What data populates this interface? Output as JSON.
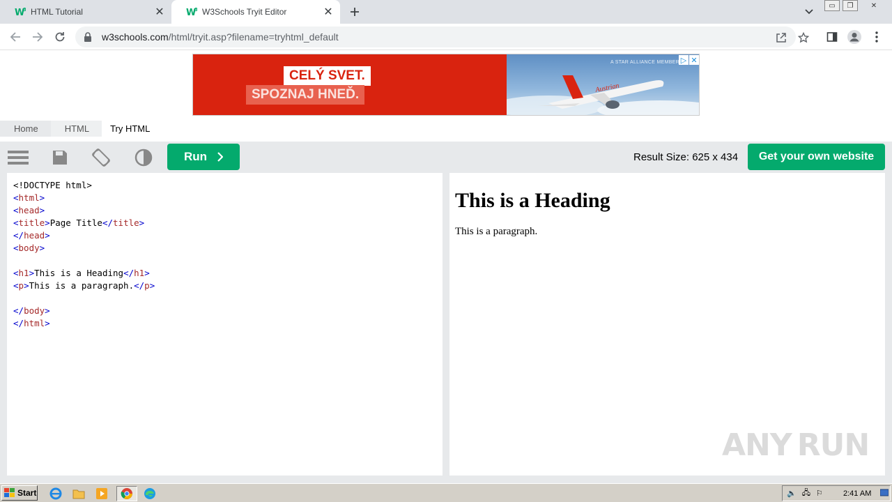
{
  "browser": {
    "tabs": [
      {
        "title": "HTML Tutorial",
        "active": false
      },
      {
        "title": "W3Schools Tryit Editor",
        "active": true
      }
    ],
    "url": {
      "host": "w3schools.com",
      "path": "/html/tryit.asp?filename=tryhtml_default"
    },
    "icons": {
      "back": "arrow-left-icon",
      "forward": "arrow-right-icon",
      "reload": "reload-icon",
      "lock": "lock-icon",
      "share": "share-icon",
      "bookmark": "star-icon",
      "sidepanel": "side-panel-icon",
      "profile": "profile-icon",
      "menu": "kebab-menu-icon"
    }
  },
  "ad": {
    "line1": "CELÝ SVET.",
    "line2": "SPOZNAJ HNEĎ.",
    "alliance": "A STAR ALLIANCE MEMBER",
    "brand": "Austrian",
    "colors": {
      "red": "#d9230f",
      "sky": "#8fb6dc"
    }
  },
  "breadcrumb": [
    "Home",
    "HTML",
    "Try HTML"
  ],
  "editor": {
    "run_label": "Run",
    "result_size": "Result Size: 625 x 434",
    "get_website": "Get your own website",
    "accent": "#04aa6d",
    "code": [
      {
        "parts": [
          {
            "t": "<!DOCTYPE html>",
            "c": "plain"
          }
        ]
      },
      {
        "parts": [
          {
            "t": "<",
            "c": "br"
          },
          {
            "t": "html",
            "c": "tag"
          },
          {
            "t": ">",
            "c": "br"
          }
        ]
      },
      {
        "parts": [
          {
            "t": "<",
            "c": "br"
          },
          {
            "t": "head",
            "c": "tag"
          },
          {
            "t": ">",
            "c": "br"
          }
        ]
      },
      {
        "parts": [
          {
            "t": "<",
            "c": "br"
          },
          {
            "t": "title",
            "c": "tag"
          },
          {
            "t": ">",
            "c": "br"
          },
          {
            "t": "Page Title",
            "c": "plain"
          },
          {
            "t": "</",
            "c": "br"
          },
          {
            "t": "title",
            "c": "tag"
          },
          {
            "t": ">",
            "c": "br"
          }
        ]
      },
      {
        "parts": [
          {
            "t": "</",
            "c": "br"
          },
          {
            "t": "head",
            "c": "tag"
          },
          {
            "t": ">",
            "c": "br"
          }
        ]
      },
      {
        "parts": [
          {
            "t": "<",
            "c": "br"
          },
          {
            "t": "body",
            "c": "tag"
          },
          {
            "t": ">",
            "c": "br"
          }
        ]
      },
      {
        "parts": []
      },
      {
        "parts": [
          {
            "t": "<",
            "c": "br"
          },
          {
            "t": "h1",
            "c": "tag"
          },
          {
            "t": ">",
            "c": "br"
          },
          {
            "t": "This is a Heading",
            "c": "plain"
          },
          {
            "t": "</",
            "c": "br"
          },
          {
            "t": "h1",
            "c": "tag"
          },
          {
            "t": ">",
            "c": "br"
          }
        ]
      },
      {
        "parts": [
          {
            "t": "<",
            "c": "br"
          },
          {
            "t": "p",
            "c": "tag"
          },
          {
            "t": ">",
            "c": "br"
          },
          {
            "t": "This is a paragraph.",
            "c": "plain"
          },
          {
            "t": "</",
            "c": "br"
          },
          {
            "t": "p",
            "c": "tag"
          },
          {
            "t": ">",
            "c": "br"
          }
        ]
      },
      {
        "parts": []
      },
      {
        "parts": [
          {
            "t": "</",
            "c": "br"
          },
          {
            "t": "body",
            "c": "tag"
          },
          {
            "t": ">",
            "c": "br"
          }
        ]
      },
      {
        "parts": [
          {
            "t": "</",
            "c": "br"
          },
          {
            "t": "html",
            "c": "tag"
          },
          {
            "t": ">",
            "c": "br"
          }
        ]
      }
    ]
  },
  "result": {
    "heading": "This is a Heading",
    "paragraph": "This is a paragraph."
  },
  "watermark": {
    "left": "ANY",
    "right": "RUN"
  },
  "taskbar": {
    "start_label": "Start",
    "clock": "2:41 AM"
  }
}
